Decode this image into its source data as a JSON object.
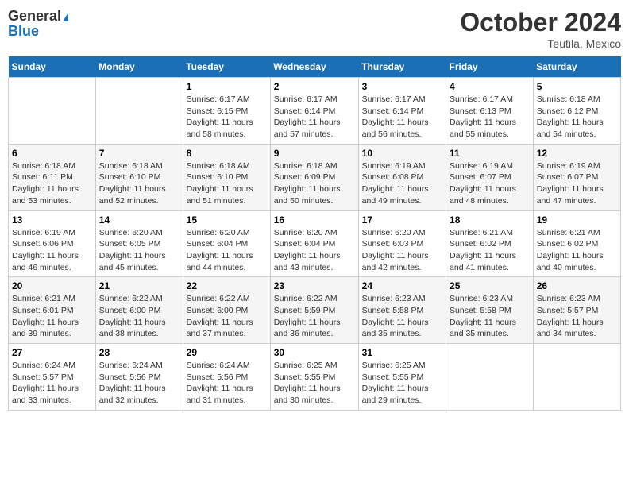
{
  "header": {
    "logo_general": "General",
    "logo_blue": "Blue",
    "month": "October 2024",
    "location": "Teutila, Mexico"
  },
  "days_of_week": [
    "Sunday",
    "Monday",
    "Tuesday",
    "Wednesday",
    "Thursday",
    "Friday",
    "Saturday"
  ],
  "weeks": [
    [
      {
        "day": "",
        "info": ""
      },
      {
        "day": "",
        "info": ""
      },
      {
        "day": "1",
        "sunrise": "6:17 AM",
        "sunset": "6:15 PM",
        "daylight": "11 hours and 58 minutes."
      },
      {
        "day": "2",
        "sunrise": "6:17 AM",
        "sunset": "6:14 PM",
        "daylight": "11 hours and 57 minutes."
      },
      {
        "day": "3",
        "sunrise": "6:17 AM",
        "sunset": "6:14 PM",
        "daylight": "11 hours and 56 minutes."
      },
      {
        "day": "4",
        "sunrise": "6:17 AM",
        "sunset": "6:13 PM",
        "daylight": "11 hours and 55 minutes."
      },
      {
        "day": "5",
        "sunrise": "6:18 AM",
        "sunset": "6:12 PM",
        "daylight": "11 hours and 54 minutes."
      }
    ],
    [
      {
        "day": "6",
        "sunrise": "6:18 AM",
        "sunset": "6:11 PM",
        "daylight": "11 hours and 53 minutes."
      },
      {
        "day": "7",
        "sunrise": "6:18 AM",
        "sunset": "6:10 PM",
        "daylight": "11 hours and 52 minutes."
      },
      {
        "day": "8",
        "sunrise": "6:18 AM",
        "sunset": "6:10 PM",
        "daylight": "11 hours and 51 minutes."
      },
      {
        "day": "9",
        "sunrise": "6:18 AM",
        "sunset": "6:09 PM",
        "daylight": "11 hours and 50 minutes."
      },
      {
        "day": "10",
        "sunrise": "6:19 AM",
        "sunset": "6:08 PM",
        "daylight": "11 hours and 49 minutes."
      },
      {
        "day": "11",
        "sunrise": "6:19 AM",
        "sunset": "6:07 PM",
        "daylight": "11 hours and 48 minutes."
      },
      {
        "day": "12",
        "sunrise": "6:19 AM",
        "sunset": "6:07 PM",
        "daylight": "11 hours and 47 minutes."
      }
    ],
    [
      {
        "day": "13",
        "sunrise": "6:19 AM",
        "sunset": "6:06 PM",
        "daylight": "11 hours and 46 minutes."
      },
      {
        "day": "14",
        "sunrise": "6:20 AM",
        "sunset": "6:05 PM",
        "daylight": "11 hours and 45 minutes."
      },
      {
        "day": "15",
        "sunrise": "6:20 AM",
        "sunset": "6:04 PM",
        "daylight": "11 hours and 44 minutes."
      },
      {
        "day": "16",
        "sunrise": "6:20 AM",
        "sunset": "6:04 PM",
        "daylight": "11 hours and 43 minutes."
      },
      {
        "day": "17",
        "sunrise": "6:20 AM",
        "sunset": "6:03 PM",
        "daylight": "11 hours and 42 minutes."
      },
      {
        "day": "18",
        "sunrise": "6:21 AM",
        "sunset": "6:02 PM",
        "daylight": "11 hours and 41 minutes."
      },
      {
        "day": "19",
        "sunrise": "6:21 AM",
        "sunset": "6:02 PM",
        "daylight": "11 hours and 40 minutes."
      }
    ],
    [
      {
        "day": "20",
        "sunrise": "6:21 AM",
        "sunset": "6:01 PM",
        "daylight": "11 hours and 39 minutes."
      },
      {
        "day": "21",
        "sunrise": "6:22 AM",
        "sunset": "6:00 PM",
        "daylight": "11 hours and 38 minutes."
      },
      {
        "day": "22",
        "sunrise": "6:22 AM",
        "sunset": "6:00 PM",
        "daylight": "11 hours and 37 minutes."
      },
      {
        "day": "23",
        "sunrise": "6:22 AM",
        "sunset": "5:59 PM",
        "daylight": "11 hours and 36 minutes."
      },
      {
        "day": "24",
        "sunrise": "6:23 AM",
        "sunset": "5:58 PM",
        "daylight": "11 hours and 35 minutes."
      },
      {
        "day": "25",
        "sunrise": "6:23 AM",
        "sunset": "5:58 PM",
        "daylight": "11 hours and 35 minutes."
      },
      {
        "day": "26",
        "sunrise": "6:23 AM",
        "sunset": "5:57 PM",
        "daylight": "11 hours and 34 minutes."
      }
    ],
    [
      {
        "day": "27",
        "sunrise": "6:24 AM",
        "sunset": "5:57 PM",
        "daylight": "11 hours and 33 minutes."
      },
      {
        "day": "28",
        "sunrise": "6:24 AM",
        "sunset": "5:56 PM",
        "daylight": "11 hours and 32 minutes."
      },
      {
        "day": "29",
        "sunrise": "6:24 AM",
        "sunset": "5:56 PM",
        "daylight": "11 hours and 31 minutes."
      },
      {
        "day": "30",
        "sunrise": "6:25 AM",
        "sunset": "5:55 PM",
        "daylight": "11 hours and 30 minutes."
      },
      {
        "day": "31",
        "sunrise": "6:25 AM",
        "sunset": "5:55 PM",
        "daylight": "11 hours and 29 minutes."
      },
      {
        "day": "",
        "info": ""
      },
      {
        "day": "",
        "info": ""
      }
    ]
  ]
}
